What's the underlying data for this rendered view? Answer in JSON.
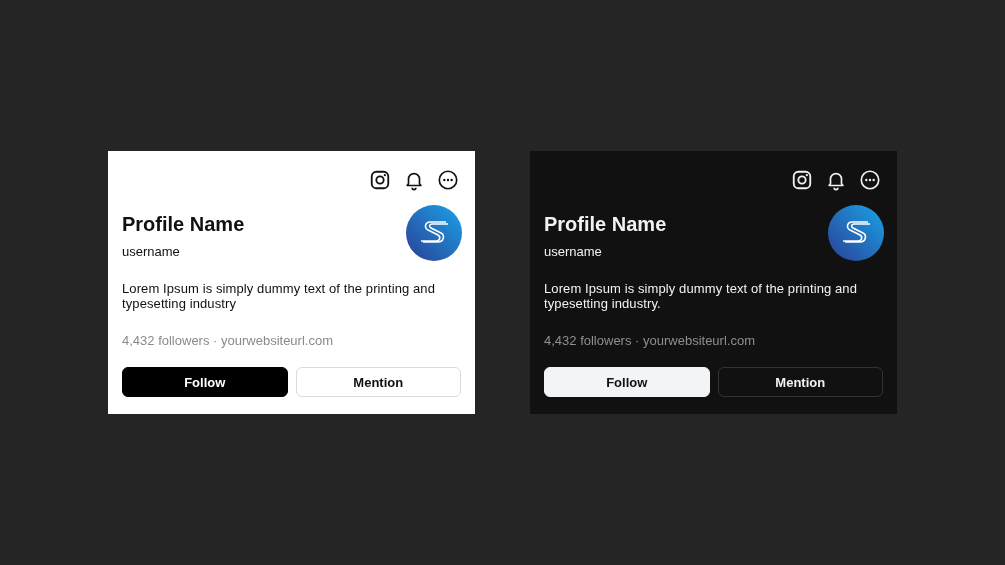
{
  "cards": [
    {
      "kind": "light",
      "name": "Profile Name",
      "username": "username",
      "bio": "Lorem Ipsum is simply dummy text of the printing and typesetting industry",
      "meta": "4,432 followers · yourwebsiteurl.com",
      "buttons": [
        {
          "label": "Follow",
          "kind": "primary"
        },
        {
          "label": "Mention",
          "kind": "secondary"
        }
      ]
    },
    {
      "kind": "dark",
      "name": "Profile Name",
      "username": "username",
      "bio": "Lorem Ipsum is simply dummy text of the printing and typesetting industry.",
      "meta": "4,432 followers · yourwebsiteurl.com",
      "buttons": [
        {
          "label": "Follow",
          "kind": "primary"
        },
        {
          "label": "Mention",
          "kind": "secondary"
        }
      ]
    }
  ]
}
